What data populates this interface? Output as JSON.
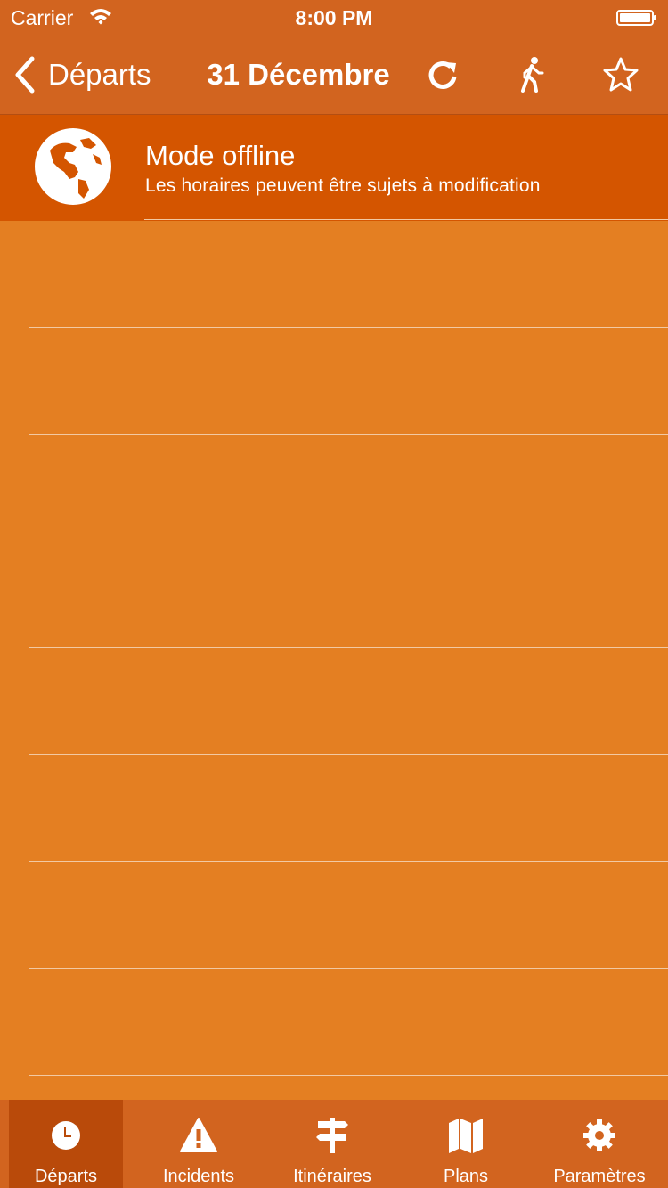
{
  "status": {
    "carrier": "Carrier",
    "time": "8:00 PM"
  },
  "nav": {
    "back_label": "Départs",
    "title": "31 Décembre",
    "icons": [
      "refresh-icon",
      "walking-icon",
      "star-icon"
    ]
  },
  "banner": {
    "title": "Mode offline",
    "subtitle": "Les horaires peuvent être sujets à modification"
  },
  "list": {
    "empty_rows": 8
  },
  "tabs": [
    {
      "label": "Départs",
      "icon": "clock-icon",
      "active": true
    },
    {
      "label": "Incidents",
      "icon": "warning-icon",
      "active": false
    },
    {
      "label": "Itinéraires",
      "icon": "signpost-icon",
      "active": false
    },
    {
      "label": "Plans",
      "icon": "map-icon",
      "active": false
    },
    {
      "label": "Paramètres",
      "icon": "gear-icon",
      "active": false
    }
  ],
  "colors": {
    "nav": "#D2641F",
    "banner": "#D45500",
    "background": "#E47F22",
    "tab_active": "#B94A0A"
  }
}
